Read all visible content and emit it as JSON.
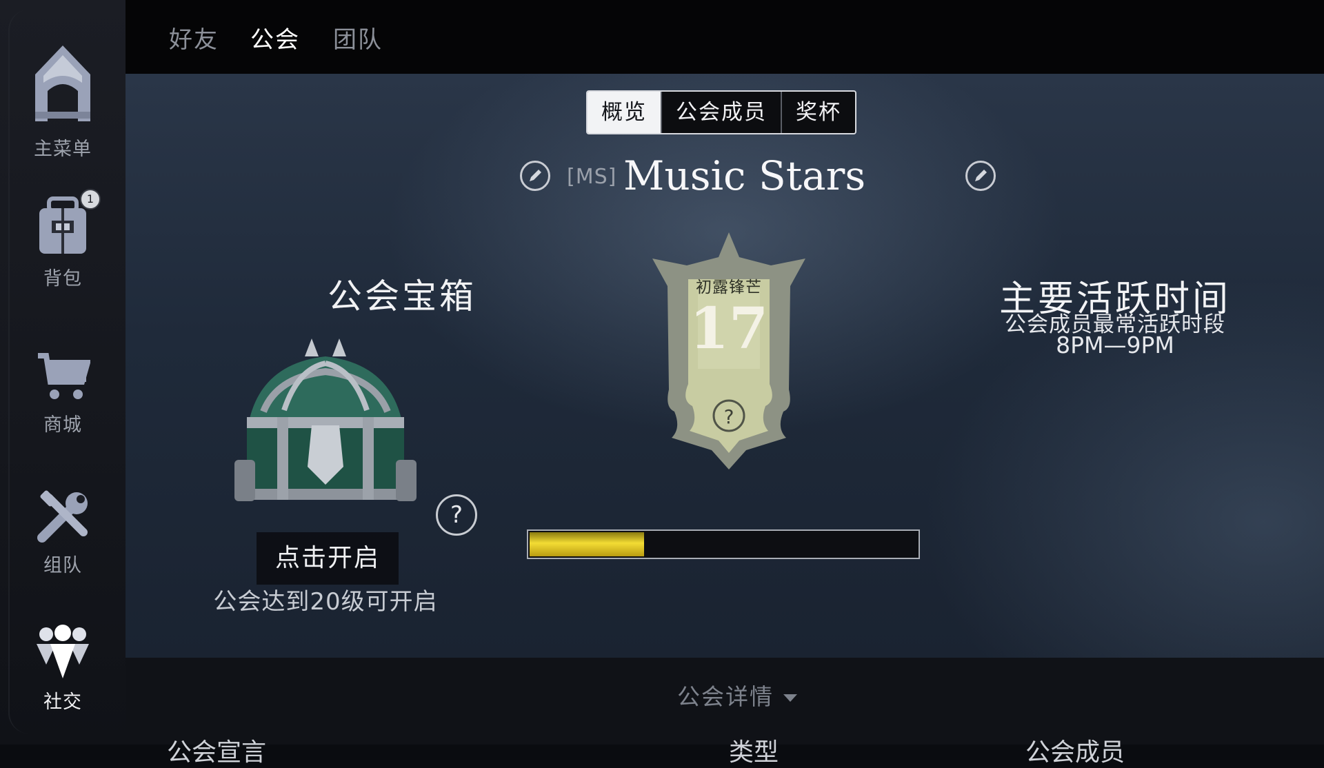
{
  "sidebar": {
    "items": [
      {
        "label": "主菜单",
        "icon": "home-icon"
      },
      {
        "label": "背包",
        "icon": "backpack-icon",
        "badge": "1"
      },
      {
        "label": "商城",
        "icon": "cart-icon"
      },
      {
        "label": "组队",
        "icon": "team-tools-icon"
      },
      {
        "label": "社交",
        "icon": "social-icon",
        "active": true
      }
    ]
  },
  "topbar": {
    "tabs": [
      {
        "label": "好友"
      },
      {
        "label": "公会",
        "active": true
      },
      {
        "label": "团队"
      }
    ]
  },
  "guild": {
    "segments": [
      {
        "label": "概览",
        "active": true
      },
      {
        "label": "公会成员"
      },
      {
        "label": "奖杯"
      }
    ],
    "tag": "[MS]",
    "name": "Music Stars",
    "chest": {
      "title": "公会宝箱",
      "open_label": "点击开启",
      "note": "公会达到20级可开启",
      "help": "?"
    },
    "level": {
      "rank_name": "初露锋芒",
      "value": "17",
      "help": "?",
      "progress": 0.3
    },
    "active_time": {
      "title": "主要活跃时间",
      "subtitle": "公会成员最常活跃时段",
      "hours": "8PM—9PM"
    }
  },
  "bottom": {
    "details_label": "公会详情",
    "partial_headers": [
      "公会宣言",
      "类型",
      "公会成员"
    ]
  },
  "colors": {
    "progress_fill": "#f3dc34",
    "panel_bg": "#1f2a3a"
  }
}
